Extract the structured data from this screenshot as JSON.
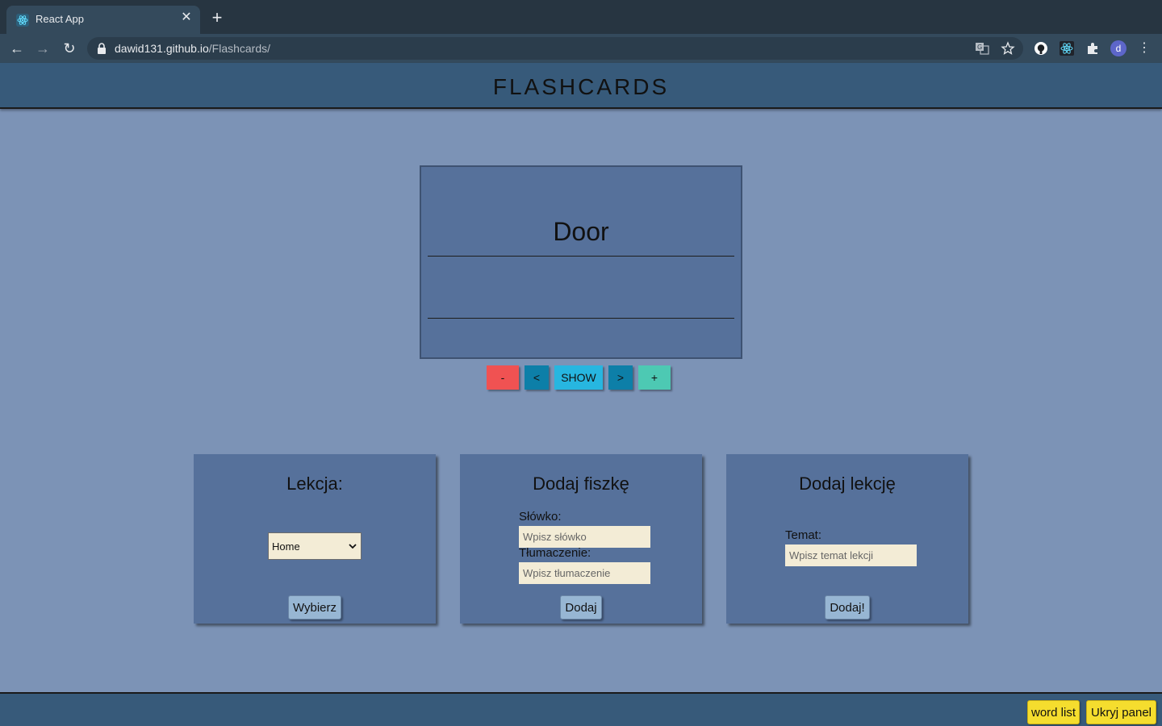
{
  "browser": {
    "tab_title": "React App",
    "url_host": "dawid131.github.io",
    "url_path": "/Flashcards/",
    "avatar_letter": "d",
    "icons": [
      "react-icon",
      "close-icon",
      "plus-icon",
      "back-icon",
      "forward-icon",
      "reload-icon",
      "lock-icon",
      "translate-icon",
      "star-icon",
      "github-icon",
      "react-devtools-icon",
      "extensions-icon",
      "menu-icon"
    ]
  },
  "app": {
    "title": "FLASHCARDS",
    "card": {
      "word": "Door",
      "translation": ""
    },
    "controls": {
      "minus_label": "-",
      "prev_label": "<",
      "show_label": "SHOW",
      "next_label": ">",
      "plus_label": "+"
    },
    "lesson_panel": {
      "title": "Lekcja:",
      "selected": "Home",
      "button": "Wybierz"
    },
    "add_card_panel": {
      "title": "Dodaj fiszkę",
      "word_label": "Słówko:",
      "word_placeholder": "Wpisz słówko",
      "translation_label": "Tłumaczenie:",
      "translation_placeholder": "Wpisz tłumaczenie",
      "button": "Dodaj"
    },
    "add_lesson_panel": {
      "title": "Dodaj lekcję",
      "topic_label": "Temat:",
      "topic_placeholder": "Wpisz temat lekcji",
      "button": "Dodaj!"
    },
    "footer": {
      "word_list_label": "word list",
      "hide_panel_label": "Ukryj panel"
    }
  },
  "colors": {
    "page_bg": "#7c93b6",
    "header_bg": "#375a7a",
    "card_bg": "#56719b",
    "minus_btn": "#f05252",
    "nav_btn": "#0d7fa8",
    "show_btn": "#27b6e0",
    "plus_btn": "#4dc9b3",
    "input_bg": "#f3ecd6",
    "footer_btn": "#f5dd2e"
  }
}
